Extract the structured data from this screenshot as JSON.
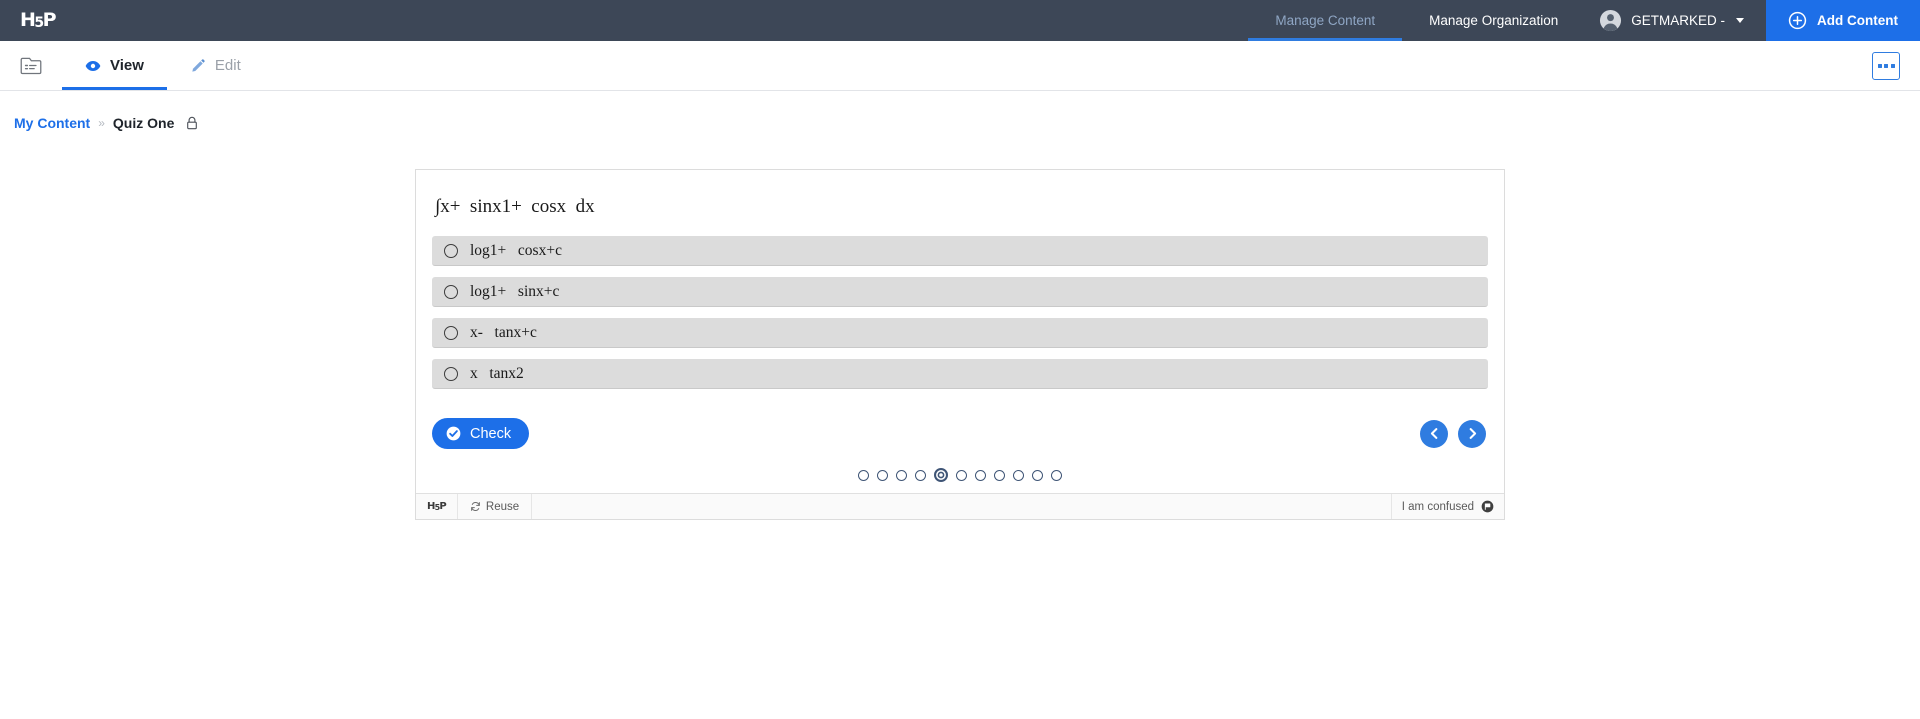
{
  "topbar": {
    "logo": "H5P",
    "nav_items": [
      {
        "label": "Manage Content",
        "active": true
      },
      {
        "label": "Manage Organization",
        "active": false
      }
    ],
    "user": {
      "name": "GETMARKED -",
      "icon": "user-avatar-icon"
    },
    "add_button": {
      "label": "Add Content",
      "icon": "plus-circle-icon"
    },
    "accent_color": "#1d6fe8",
    "background_color": "#3d4757"
  },
  "toolbar": {
    "folder_icon": "folder-list-icon",
    "tabs": [
      {
        "label": "View",
        "icon": "eye-icon",
        "active": true
      },
      {
        "label": "Edit",
        "icon": "pencil-icon",
        "active": false
      }
    ],
    "more_label": "More options",
    "more_icon": "ellipsis-icon"
  },
  "breadcrumb": {
    "root": "My Content",
    "separator": "»",
    "current": "Quiz One",
    "lock_icon": "lock-icon"
  },
  "quiz": {
    "question": "∫x+  sinx1+  cosx  dx",
    "options": [
      {
        "text": "log1+   cosx+c",
        "selected": false
      },
      {
        "text": "log1+   sinx+c",
        "selected": false
      },
      {
        "text": "x-   tanx+c",
        "selected": false
      },
      {
        "text": "x   tanx2",
        "selected": false
      }
    ],
    "check_button": {
      "label": "Check",
      "icon": "check-circle-icon"
    },
    "prev_button": {
      "label": "Previous",
      "icon": "chevron-left-icon"
    },
    "next_button": {
      "label": "Next",
      "icon": "chevron-right-icon"
    },
    "pagination": {
      "total": 11,
      "current": 5
    },
    "footer": {
      "logo": "H5P",
      "reuse_label": "Reuse",
      "reuse_icon": "rotate-icon",
      "confused_label": "I am confused",
      "confused_icon": "flag-icon"
    }
  }
}
